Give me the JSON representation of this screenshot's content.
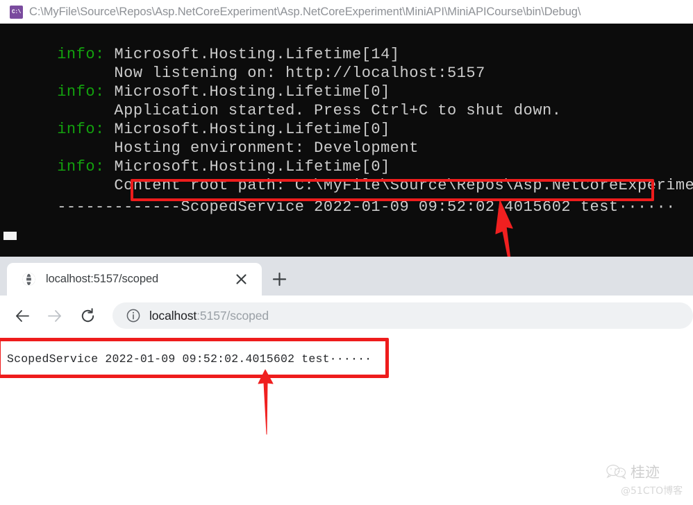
{
  "console": {
    "icon": "cmd-console-icon",
    "icon_label": "C:\\",
    "title": "C:\\MyFile\\Source\\Repos\\Asp.NetCoreExperiment\\Asp.NetCoreExperiment\\MiniAPI\\MiniAPICourse\\bin\\Debug\\",
    "lines": [
      {
        "level": "info: ",
        "text": "Microsoft.Hosting.Lifetime[14]"
      },
      {
        "level": "",
        "text": "      Now listening on: http://localhost:5157"
      },
      {
        "level": "info: ",
        "text": "Microsoft.Hosting.Lifetime[0]"
      },
      {
        "level": "",
        "text": "      Application started. Press Ctrl+C to shut down."
      },
      {
        "level": "info: ",
        "text": "Microsoft.Hosting.Lifetime[0]"
      },
      {
        "level": "",
        "text": "      Hosting environment: Development"
      },
      {
        "level": "info: ",
        "text": "Microsoft.Hosting.Lifetime[0]"
      },
      {
        "level": "",
        "text": "      Content root path: C:\\MyFile\\Source\\Repos\\Asp.NetCoreExperiment\\A"
      },
      {
        "level": "",
        "text": "-------------ScopedService 2022-01-09 09:52:02.4015602 test······"
      }
    ],
    "highlighted_line": "ScopedService 2022-01-09 09:52:02.4015602 test······"
  },
  "browser": {
    "tab": {
      "favicon": "globe-icon",
      "title": "localhost:5157/scoped",
      "close_label": "×"
    },
    "new_tab_label": "+",
    "toolbar": {
      "back": "back-arrow-icon",
      "forward": "forward-arrow-icon",
      "reload": "reload-icon",
      "site_info": "info-circle-icon",
      "url_host": "localhost",
      "url_rest": ":5157/scoped",
      "url_full": "localhost:5157/scoped"
    },
    "page": {
      "body_text": "ScopedService 2022-01-09 09:52:02.4015602 test······"
    }
  },
  "annotations": {
    "box_color": "#ee1c1c",
    "arrow_color": "#f02020",
    "arrow_console_label": "arrow-to-console-output",
    "arrow_page_label": "arrow-to-page-output"
  },
  "watermark": {
    "icon": "wechat-icon",
    "name": "桂迹",
    "handle": "@51CTO博客"
  }
}
